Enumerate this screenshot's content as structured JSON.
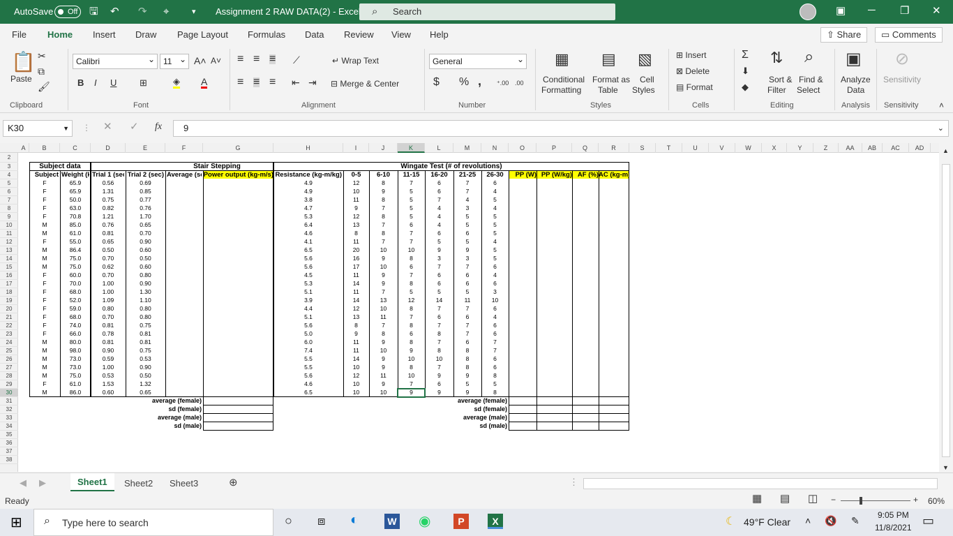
{
  "titlebar": {
    "autosave": "AutoSave",
    "autosave_state": "Off",
    "title": "Assignment 2 RAW DATA(2)  -  Excel",
    "search": "Search"
  },
  "menu": [
    "File",
    "Home",
    "Insert",
    "Draw",
    "Page Layout",
    "Formulas",
    "Data",
    "Review",
    "View",
    "Help"
  ],
  "share": "Share",
  "comments": "Comments",
  "ribbon": {
    "paste": "Paste",
    "clipboard": "Clipboard",
    "font_name": "Calibri",
    "font_size": "11",
    "font": "Font",
    "wrap": "Wrap Text",
    "merge": "Merge & Center",
    "alignment": "Alignment",
    "numfmt": "General",
    "number": "Number",
    "cond1": "Conditional",
    "cond2": "Formatting",
    "fmt1": "Format as",
    "fmt2": "Table",
    "cell1": "Cell",
    "cell2": "Styles",
    "styles": "Styles",
    "insert": "Insert",
    "delete": "Delete",
    "format": "Format",
    "cells": "Cells",
    "sort1": "Sort &",
    "sort2": "Filter",
    "find1": "Find &",
    "find2": "Select",
    "editing": "Editing",
    "an1": "Analyze",
    "an2": "Data",
    "analysis": "Analysis",
    "sens": "Sensitivity",
    "sensitivity": "Sensitivity"
  },
  "namebox": "K30",
  "formula": "9",
  "columns": [
    "A",
    "B",
    "C",
    "D",
    "E",
    "F",
    "G",
    "H",
    "I",
    "J",
    "K",
    "L",
    "M",
    "N",
    "O",
    "P",
    "Q",
    "R",
    "S",
    "T",
    "U",
    "V",
    "W",
    "X",
    "Y",
    "Z",
    "AA",
    "AB",
    "AC",
    "AD"
  ],
  "rows": [
    "2",
    "3",
    "4",
    "5",
    "6",
    "7",
    "8",
    "9",
    "10",
    "11",
    "12",
    "13",
    "14",
    "15",
    "16",
    "17",
    "18",
    "19",
    "20",
    "21",
    "22",
    "23",
    "24",
    "25",
    "26",
    "27",
    "28",
    "29",
    "30",
    "31",
    "32",
    "33",
    "34",
    "35",
    "36",
    "37",
    "38"
  ],
  "headers": {
    "subject_data": "Subject data",
    "stair": "Stair Stepping",
    "wingate": "Wingate Test (# of revolutions)",
    "subject": "Subject",
    "weight": "Weight (kg)",
    "trial1": "Trial 1 (sec)",
    "trial2": "Trial 2 (sec)",
    "average": "Average (sec)",
    "power": "Power output (kg-m/s)",
    "resistance": "Resistance (kg-m/kg)",
    "w1": "0-5",
    "w2": "6-10",
    "w3": "11-15",
    "w4": "16-20",
    "w5": "21-25",
    "w6": "26-30",
    "pp": "PP (W)",
    "ppk": "PP (W/kg)",
    "af": "AF (%)",
    "ac": "AC (kg-m)"
  },
  "data": [
    [
      "F",
      "65.9",
      "0.56",
      "0.69",
      "4.9",
      "12",
      "8",
      "7",
      "6",
      "7",
      "6"
    ],
    [
      "F",
      "65.9",
      "1.31",
      "0.85",
      "4.9",
      "10",
      "9",
      "5",
      "6",
      "7",
      "4"
    ],
    [
      "F",
      "50.0",
      "0.75",
      "0.77",
      "3.8",
      "11",
      "8",
      "5",
      "7",
      "4",
      "5"
    ],
    [
      "F",
      "63.0",
      "0.82",
      "0.76",
      "4.7",
      "9",
      "7",
      "5",
      "4",
      "3",
      "4"
    ],
    [
      "F",
      "70.8",
      "1.21",
      "1.70",
      "5.3",
      "12",
      "8",
      "5",
      "4",
      "5",
      "5"
    ],
    [
      "M",
      "85.0",
      "0.76",
      "0.65",
      "6.4",
      "13",
      "7",
      "6",
      "4",
      "5",
      "5"
    ],
    [
      "M",
      "61.0",
      "0.81",
      "0.70",
      "4.6",
      "8",
      "8",
      "7",
      "6",
      "6",
      "5"
    ],
    [
      "F",
      "55.0",
      "0.65",
      "0.90",
      "4.1",
      "11",
      "7",
      "7",
      "5",
      "5",
      "4"
    ],
    [
      "M",
      "86.4",
      "0.50",
      "0.60",
      "6.5",
      "20",
      "10",
      "10",
      "9",
      "9",
      "5"
    ],
    [
      "M",
      "75.0",
      "0.70",
      "0.50",
      "5.6",
      "16",
      "9",
      "8",
      "3",
      "3",
      "5"
    ],
    [
      "M",
      "75.0",
      "0.62",
      "0.60",
      "5.6",
      "17",
      "10",
      "6",
      "7",
      "7",
      "6"
    ],
    [
      "F",
      "60.0",
      "0.70",
      "0.80",
      "4.5",
      "11",
      "9",
      "7",
      "6",
      "6",
      "4"
    ],
    [
      "F",
      "70.0",
      "1.00",
      "0.90",
      "5.3",
      "14",
      "9",
      "8",
      "6",
      "6",
      "6"
    ],
    [
      "F",
      "68.0",
      "1.00",
      "1.30",
      "5.1",
      "11",
      "7",
      "5",
      "5",
      "5",
      "3"
    ],
    [
      "F",
      "52.0",
      "1.09",
      "1.10",
      "3.9",
      "14",
      "13",
      "12",
      "14",
      "11",
      "10"
    ],
    [
      "F",
      "59.0",
      "0.80",
      "0.80",
      "4.4",
      "12",
      "10",
      "8",
      "7",
      "7",
      "6"
    ],
    [
      "F",
      "68.0",
      "0.70",
      "0.80",
      "5.1",
      "13",
      "11",
      "7",
      "6",
      "6",
      "4"
    ],
    [
      "F",
      "74.0",
      "0.81",
      "0.75",
      "5.6",
      "8",
      "7",
      "8",
      "7",
      "7",
      "6"
    ],
    [
      "F",
      "66.0",
      "0.78",
      "0.81",
      "5.0",
      "9",
      "8",
      "6",
      "8",
      "7",
      "6"
    ],
    [
      "M",
      "80.0",
      "0.81",
      "0.81",
      "6.0",
      "11",
      "9",
      "8",
      "7",
      "6",
      "7"
    ],
    [
      "M",
      "98.0",
      "0.90",
      "0.75",
      "7.4",
      "11",
      "10",
      "9",
      "8",
      "8",
      "7"
    ],
    [
      "M",
      "73.0",
      "0.59",
      "0.53",
      "5.5",
      "14",
      "9",
      "10",
      "10",
      "8",
      "6"
    ],
    [
      "M",
      "73.0",
      "1.00",
      "0.90",
      "5.5",
      "10",
      "9",
      "8",
      "7",
      "8",
      "6"
    ],
    [
      "M",
      "75.0",
      "0.53",
      "0.50",
      "5.6",
      "12",
      "11",
      "10",
      "9",
      "9",
      "8"
    ],
    [
      "F",
      "61.0",
      "1.53",
      "1.32",
      "4.6",
      "10",
      "9",
      "7",
      "6",
      "5",
      "5"
    ],
    [
      "M",
      "86.0",
      "0.60",
      "0.65",
      "6.5",
      "10",
      "10",
      "9",
      "9",
      "9",
      "8"
    ]
  ],
  "summary": [
    "average (female)",
    "sd (female)",
    "average (male)",
    "sd (male)"
  ],
  "sheets": [
    "Sheet1",
    "Sheet2",
    "Sheet3"
  ],
  "status": "Ready",
  "zoom": "60%",
  "taskbar": {
    "search": "Type here to search",
    "weather": "49°F  Clear",
    "time": "9:05 PM",
    "date": "11/8/2021"
  }
}
